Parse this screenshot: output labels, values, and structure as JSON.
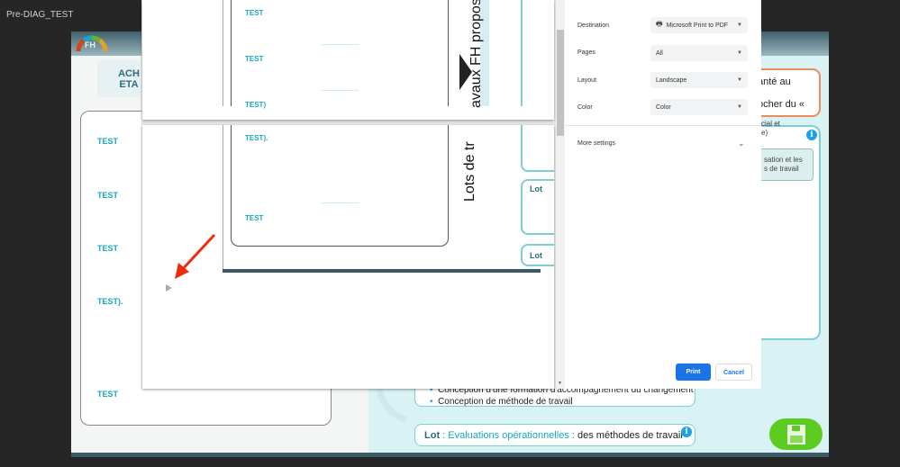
{
  "window": {
    "title": "Pre-DIAG_TEST"
  },
  "app": {
    "logo_text": "FH",
    "header_box": {
      "line1": "ACH",
      "line2": "ETA"
    },
    "left_card": {
      "items": [
        "TEST",
        "TEST",
        "TEST",
        "TEST).",
        "TEST"
      ]
    },
    "orange_box": {
      "line1": "anté au",
      "line2": "ocher du «"
    },
    "cyan_card": {
      "line1": "cial et",
      "line2": "e)",
      "inner_line1": "sation et les",
      "inner_line2": "s de travail"
    },
    "lot_box": {
      "bullets": [
        "Conception d'une formation d'accompagnement du changement",
        "Conception de méthode de travail"
      ]
    },
    "lot_eval": {
      "prefix": "Lot",
      "highlight": " : Evaluations opérationnelles : ",
      "rest": "des méthodes de travail"
    },
    "save_icon": "floppy-disk-icon"
  },
  "preview": {
    "page1": {
      "items": [
        "TEST",
        "TEST",
        "TEST)"
      ],
      "vertical_text": "avaux FH propos"
    },
    "page2": {
      "items": [
        "TEST).",
        "TEST"
      ],
      "vertical_text": "Lots de tr",
      "lot_labels": [
        "Lot",
        "Lot"
      ]
    }
  },
  "print_settings": {
    "destination": {
      "label": "Destination",
      "value": "Microsoft Print to PDF"
    },
    "pages": {
      "label": "Pages",
      "value": "All"
    },
    "layout": {
      "label": "Layout",
      "value": "Landscape"
    },
    "color": {
      "label": "Color",
      "value": "Color"
    },
    "more_settings": "More settings",
    "print_button": "Print",
    "cancel_button": "Cancel"
  },
  "colors": {
    "accent": "#1a73e8",
    "teal": "#17a7c0",
    "save_green": "#5ccc22",
    "arrow": "#f02a10"
  }
}
